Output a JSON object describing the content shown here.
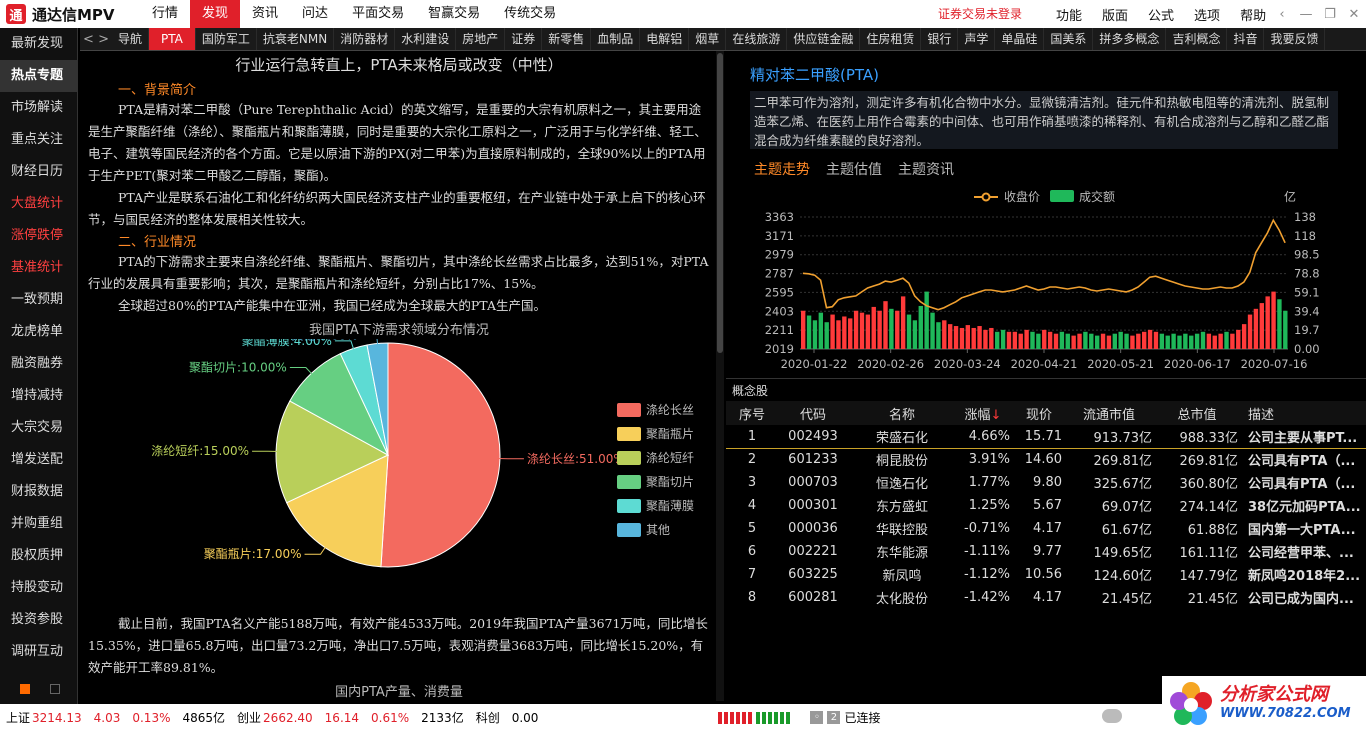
{
  "app": {
    "title": "通达信MPV",
    "logo_glyph": "通"
  },
  "menu": {
    "items": [
      "行情",
      "发现",
      "资讯",
      "问达",
      "平面交易",
      "智赢交易",
      "传统交易"
    ],
    "active_index": 1,
    "login": "证券交易未登录",
    "right_items": [
      "功能",
      "版面",
      "公式",
      "选项",
      "帮助"
    ],
    "window_controls": [
      "‹",
      "—",
      "❐",
      "✕"
    ]
  },
  "sidebar": {
    "items": [
      {
        "label": "最新发现",
        "style": "normal"
      },
      {
        "label": "热点专题",
        "style": "active"
      },
      {
        "label": "市场解读",
        "style": "normal"
      },
      {
        "label": "重点关注",
        "style": "normal"
      },
      {
        "label": "财经日历",
        "style": "normal"
      },
      {
        "label": "大盘统计",
        "style": "red"
      },
      {
        "label": "涨停跌停",
        "style": "red"
      },
      {
        "label": "基准统计",
        "style": "red"
      },
      {
        "label": "一致预期",
        "style": "normal"
      },
      {
        "label": "龙虎榜单",
        "style": "normal"
      },
      {
        "label": "融资融券",
        "style": "normal"
      },
      {
        "label": "增持减持",
        "style": "normal"
      },
      {
        "label": "大宗交易",
        "style": "normal"
      },
      {
        "label": "增发送配",
        "style": "normal"
      },
      {
        "label": "财报数据",
        "style": "normal"
      },
      {
        "label": "并购重组",
        "style": "normal"
      },
      {
        "label": "股权质押",
        "style": "normal"
      },
      {
        "label": "持股变动",
        "style": "normal"
      },
      {
        "label": "投资参股",
        "style": "normal"
      },
      {
        "label": "调研互动",
        "style": "normal"
      }
    ]
  },
  "tabs": {
    "nav_prev": "<",
    "nav_next": ">",
    "items": [
      "导航",
      "PTA",
      "国防军工",
      "抗衰老NMN",
      "消防器材",
      "水利建设",
      "房地产",
      "证券",
      "新零售",
      "血制品",
      "电解铝",
      "烟草",
      "在线旅游",
      "供应链金融",
      "住房租赁",
      "银行",
      "声学",
      "单晶硅",
      "国美系",
      "拼多多概念",
      "吉利概念",
      "抖音",
      "我要反馈"
    ],
    "active_index": 1
  },
  "article": {
    "title": "行业运行急转直上，PTA未来格局或改变（中性）",
    "h1": "一、背景简介",
    "p1": "PTA是精对苯二甲酸（Pure Terephthalic Acid）的英文缩写，是重要的大宗有机原料之一，其主要用途是生产聚酯纤维（涤纶）、聚酯瓶片和聚酯薄膜，同时是重要的大宗化工原料之一，广泛用于与化学纤维、轻工、电子、建筑等国民经济的各个方面。它是以原油下游的PX(对二甲苯)为直接原料制成的，全球90%以上的PTA用于生产PET(聚对苯二甲酸乙二醇酯，聚酯)。",
    "p2": "PTA产业是联系石油化工和化纤纺织两大国民经济支柱产业的重要枢纽，在产业链中处于承上启下的核心环节，与国民经济的整体发展相关性较大。",
    "h2": "二、行业情况",
    "p3": "PTA的下游需求主要来自涤纶纤维、聚酯瓶片、聚酯切片，其中涤纶长丝需求占比最多，达到51%，对PTA行业的发展具有重要影响；其次，是聚酯瓶片和涤纶短纤，分别占比17%、15%。",
    "p4": "全球超过80%的PTA产能集中在亚洲，我国已经成为全球最大的PTA生产国。",
    "chart_caption": "我国PTA下游需求领域分布情况",
    "p5": "截止目前，我国PTA名义产能5188万吨，有效产能4533万吨。2019年我国PTA产量3671万吨，同比增长15.35%，进口量65.8万吨，出口量73.2万吨，净出口7.5万吨，表观消费量3683万吨，同比增长15.20%，有效产能开工率89.81%。",
    "chart2_caption": "国内PTA产量、消费量"
  },
  "theme": {
    "name": "精对苯二甲酸(PTA)",
    "description": "二甲苯可作为溶剂，测定许多有机化合物中水分。显微镜清洁剂。硅元件和热敏电阻等的清洗剂、脱氢制造苯乙烯、在医药上用作合霉素的中间体、也可用作硝基喷漆的稀释剂、有机合成溶剂与乙醇和乙醛乙酯混合成为纤维素醚的良好溶剂。",
    "tabs": [
      "主题走势",
      "主题估值",
      "主题资讯"
    ],
    "active_tab": 0
  },
  "concept": {
    "title": "概念股",
    "headers": {
      "idx": "序号",
      "code": "代码",
      "name": "名称",
      "chg": "涨幅",
      "sort_arrow": "↓",
      "price": "现价",
      "float": "流通市值",
      "total": "总市值",
      "desc": "描述"
    },
    "rows": [
      {
        "idx": "1",
        "code": "002493",
        "name": "荣盛石化",
        "chg": "4.66%",
        "price": "15.71",
        "float": "913.73亿",
        "total": "988.33亿",
        "desc": "公司主要从事PT...",
        "dir": "up"
      },
      {
        "idx": "2",
        "code": "601233",
        "name": "桐昆股份",
        "chg": "3.91%",
        "price": "14.60",
        "float": "269.81亿",
        "total": "269.81亿",
        "desc": "公司具有PTA（...",
        "dir": "up"
      },
      {
        "idx": "3",
        "code": "000703",
        "name": "恒逸石化",
        "chg": "1.77%",
        "price": "9.80",
        "float": "325.67亿",
        "total": "360.80亿",
        "desc": "公司具有PTA（...",
        "dir": "up"
      },
      {
        "idx": "4",
        "code": "000301",
        "name": "东方盛虹",
        "chg": "1.25%",
        "price": "5.67",
        "float": "69.07亿",
        "total": "274.14亿",
        "desc": "38亿元加码PTA...",
        "dir": "up"
      },
      {
        "idx": "5",
        "code": "000036",
        "name": "华联控股",
        "chg": "-0.71%",
        "price": "4.17",
        "float": "61.67亿",
        "total": "61.88亿",
        "desc": "国内第一大PTA...",
        "dir": "down"
      },
      {
        "idx": "6",
        "code": "002221",
        "name": "东华能源",
        "chg": "-1.11%",
        "price": "9.77",
        "float": "149.65亿",
        "total": "161.11亿",
        "desc": "公司经营甲苯、...",
        "dir": "down"
      },
      {
        "idx": "7",
        "code": "603225",
        "name": "新凤鸣",
        "chg": "-1.12%",
        "price": "10.56",
        "float": "124.60亿",
        "total": "147.79亿",
        "desc": "新凤鸣2018年2...",
        "dir": "down"
      },
      {
        "idx": "8",
        "code": "600281",
        "name": "太化股份",
        "chg": "-1.42%",
        "price": "4.17",
        "float": "21.45亿",
        "total": "21.45亿",
        "desc": "公司已成为国内...",
        "dir": "down"
      }
    ]
  },
  "status": {
    "sh_label": "上证",
    "sh_value": "3214.13",
    "sh_chg": "4.03",
    "sh_pct": "0.13%",
    "sh_amt": "4865亿",
    "cy_label": "创业",
    "cy_value": "2662.40",
    "cy_chg": "16.14",
    "cy_pct": "0.61%",
    "cy_amt": "2133亿",
    "kc_label": "科创",
    "kc_value": "0.00",
    "conn_count": "2",
    "conn_text": "已连接"
  },
  "brand": {
    "text": "分析家公式网",
    "url": "WWW.70822.COM"
  },
  "colors": {
    "accent_red": "#e0202a",
    "theme_blue": "#3aa0ff",
    "orange": "#ff8a28",
    "up": "#ff3a3a",
    "down": "#3fd14b",
    "price_line": "#f0a030",
    "volume": "#1fb85a"
  },
  "chart_data": [
    {
      "type": "pie",
      "title": "我国PTA下游需求领域分布情况",
      "legend_position": "right",
      "slices": [
        {
          "name": "涤纶长丝",
          "value": 51.0,
          "label": "涤纶长丝:51.00%",
          "color": "#f36a5f"
        },
        {
          "name": "聚酯瓶片",
          "value": 17.0,
          "label": "聚酯瓶片:17.00%",
          "color": "#f7cf5a"
        },
        {
          "name": "涤纶短纤",
          "value": 15.0,
          "label": "涤纶短纤:15.00%",
          "color": "#b9cf5a"
        },
        {
          "name": "聚酯切片",
          "value": 10.0,
          "label": "聚酯切片:10.00%",
          "color": "#66cf82"
        },
        {
          "name": "聚酯薄膜",
          "value": 4.0,
          "label": "聚酯薄膜:4.00%",
          "color": "#5ddbd3"
        },
        {
          "name": "其他",
          "value": 3.0,
          "label": "其他:3.00%",
          "color": "#58b6dd"
        }
      ]
    },
    {
      "type": "line",
      "legend_position": "top",
      "legend": [
        "收盘价",
        "成交额"
      ],
      "y_left_ticks": [
        "3363",
        "3171",
        "2979",
        "2787",
        "2595",
        "2403",
        "2211",
        "2019"
      ],
      "y_left_range": [
        2019,
        3363
      ],
      "y_right_unit": "亿",
      "y_right_ticks": [
        "138",
        "118",
        "98.5",
        "78.8",
        "59.1",
        "39.4",
        "19.7",
        "0.00"
      ],
      "y_right_range": [
        0,
        138
      ],
      "x_ticks": [
        "2020-01-22",
        "2020-02-26",
        "2020-03-24",
        "2020-04-21",
        "2020-05-21",
        "2020-06-17",
        "2020-07-16"
      ],
      "close": [
        2790,
        2785,
        2770,
        2720,
        2440,
        2450,
        2520,
        2540,
        2550,
        2560,
        2600,
        2640,
        2660,
        2680,
        2710,
        2700,
        2720,
        2740,
        2690,
        2560,
        2500,
        2460,
        2440,
        2420,
        2440,
        2470,
        2500,
        2540,
        2560,
        2580,
        2600,
        2620,
        2620,
        2610,
        2600,
        2610,
        2620,
        2640,
        2660,
        2640,
        2620,
        2630,
        2650,
        2650,
        2640,
        2630,
        2640,
        2650,
        2640,
        2620,
        2610,
        2620,
        2630,
        2620,
        2610,
        2600,
        2620,
        2650,
        2700,
        2750,
        2760,
        2740,
        2720,
        2700,
        2680,
        2660,
        2650,
        2640,
        2630,
        2630,
        2640,
        2650,
        2640,
        2640,
        2660,
        2700,
        2800,
        3000,
        3100,
        3200,
        3330,
        3230,
        3100
      ],
      "volume": [
        40,
        35,
        30,
        38,
        28,
        36,
        30,
        34,
        32,
        40,
        38,
        36,
        44,
        40,
        50,
        42,
        40,
        55,
        36,
        30,
        45,
        60,
        38,
        28,
        30,
        26,
        24,
        22,
        25,
        22,
        24,
        20,
        22,
        18,
        20,
        18,
        18,
        16,
        20,
        18,
        16,
        20,
        18,
        16,
        18,
        16,
        14,
        16,
        18,
        16,
        14,
        16,
        14,
        16,
        18,
        16,
        14,
        16,
        18,
        20,
        18,
        16,
        14,
        16,
        14,
        16,
        14,
        16,
        18,
        16,
        14,
        16,
        18,
        16,
        20,
        26,
        36,
        42,
        48,
        55,
        60,
        52,
        40
      ]
    }
  ]
}
